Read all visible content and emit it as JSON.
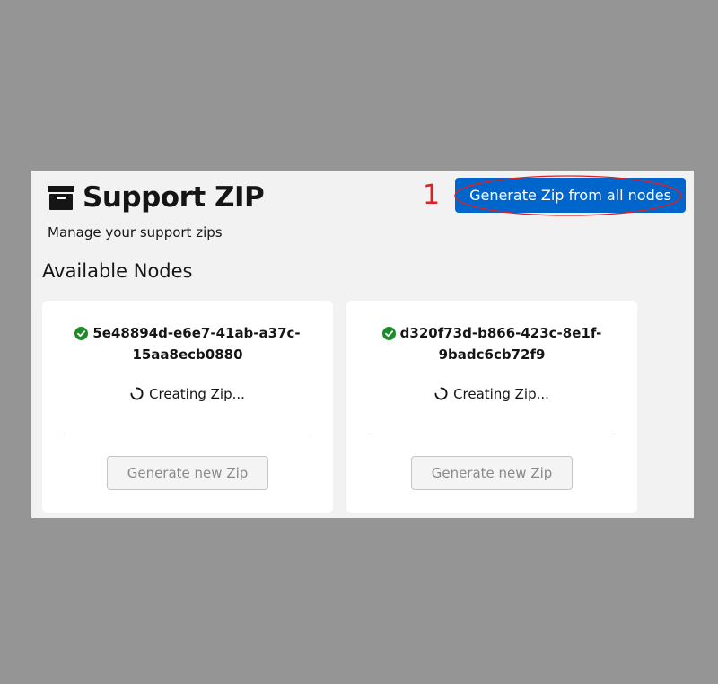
{
  "header": {
    "icon": "archive-box-icon",
    "title": "Support ZIP",
    "subtitle": "Manage your support zips",
    "annotation_number": "1",
    "generate_all_label": "Generate Zip from all nodes"
  },
  "section": {
    "title": "Available Nodes"
  },
  "nodes": [
    {
      "id": "5e48894d-e6e7-41ab-a37c-15aa8ecb0880",
      "status_icon": "check-circle-icon",
      "status": "Creating Zip...",
      "button_label": "Generate new Zip"
    },
    {
      "id": "d320f73d-b866-423c-8e1f-9badc6cb72f9",
      "status_icon": "check-circle-icon",
      "status": "Creating Zip...",
      "button_label": "Generate new Zip"
    }
  ],
  "colors": {
    "primary": "#0066cc",
    "success": "#1e8b2a",
    "annotation": "#e02020",
    "panel_bg": "#f2f2f2",
    "page_bg": "#959595"
  }
}
